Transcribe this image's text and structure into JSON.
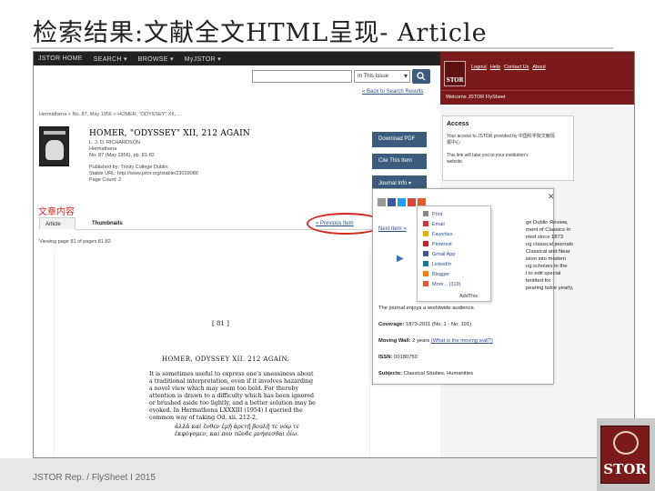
{
  "slide": {
    "title": "检索结果:文献全文HTML呈现- Article",
    "footer": "JSTOR Rep. / FlySheet  I  2015",
    "logo_word": "STOR"
  },
  "nav": {
    "items": [
      "JSTOR HOME",
      "SEARCH ▾",
      "BROWSE ▾",
      "MyJSTOR ▾"
    ]
  },
  "search": {
    "scope": "In This Issue",
    "back_link": "« Back to Search Results"
  },
  "breadcrumb": "Hermathena  >  No. 87, May 1956  >  HOMER, \"ODYSSEY\" XII, ...",
  "article": {
    "title": "HOMER, \"ODYSSEY\" XII, 212 AGAIN",
    "meta": [
      "L. J. D. RICHARDSON",
      "Hermathena",
      "No. 87 (May 1956), pp. 81-82",
      "Published by: Trinity College Dublin",
      "Stable URL: http://www.jstor.org/stable/23039080",
      "Page Count: 2"
    ]
  },
  "actions": {
    "download": "Download PDF",
    "cite": "Cite This Item",
    "journal": "Journal Info ▾"
  },
  "content_label": "文章内容",
  "tabs": [
    "Article",
    "Thumbnails"
  ],
  "prev_item": "« Previous Item",
  "next_item": "Next Item »",
  "viewing": "Viewing page 81 of pages 81-82",
  "scan": {
    "page_number": "[  81  ]",
    "title": "HOMER, ODYSSEY XII. 212 AGAIN.",
    "lines": [
      "It is sometimes useful to express one's uneasiness about",
      "a traditional interpretation, even if it involves hazarding",
      "a novel view which may seem too bold.    For thereby",
      "attention is drawn to a difficulty which has been ignored",
      "or brushed aside too lightly, and a better solution may be",
      "evoked.    In Hermathena LXXXIII (1954) I queried the",
      "common way of taking Od. xii. 212-2,",
      "ἀλλὰ καὶ ἔνθεν ἐμῇ ἀρετῇ βουλῇ τε νόῳ τε",
      "ἐκφύγομεν, καί που τῶνδε μνήσεσθαι ὀίω."
    ]
  },
  "jstor": {
    "links": [
      "Logout",
      "Help",
      "Contact Us",
      "About"
    ],
    "welcome": "Welcome JSTOR FlySheet",
    "mini_word": "STOR",
    "access_title": "Access",
    "access_lines": [
      "Your access to JSTOR provided by 中国科学院文献情",
      "报中心",
      "",
      "This link will take you to your institution's",
      "website."
    ]
  },
  "journal_panel": {
    "desc_lines": [
      "ge Dublin Review,",
      "rnent of Classics in",
      "nted since 1873",
      "ng classical journals",
      "Classical and Near",
      "ision into modern",
      "ng scholars in the",
      "l to edit special",
      "bmitted for",
      "pearing twice yearly,"
    ],
    "enjoys": "The journal enjoys a worldwide audience.",
    "coverage_label": "Coverage:",
    "coverage_value": "1873-2011 (No. 1 - No. 191)",
    "moving_wall_label": "Moving Wall:",
    "moving_wall_value": "2 years",
    "moving_wall_link": "(What is the moving wall?)",
    "issn_label": "ISSN:",
    "issn_value": "00180750",
    "subjects_label": "Subjects:",
    "subjects_value": "Classical Studies, Humanities",
    "close_icon": "✕"
  },
  "share_menu": {
    "items": [
      "Print",
      "Email",
      "Favorites",
      "Pinterest",
      "Gmail App",
      "LinkedIn",
      "Blogger",
      "More... (319)"
    ],
    "addthis": "AddThis",
    "colors": [
      "#888888",
      "#c33",
      "#e8b000",
      "#cb2027",
      "#3b5998",
      "#0e76a8",
      "#f57d00",
      "#e35a2b"
    ]
  }
}
